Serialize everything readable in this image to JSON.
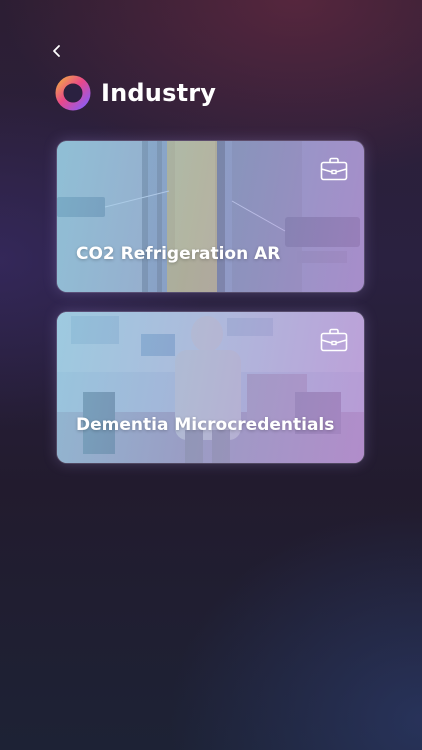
{
  "header": {
    "title": "Industry"
  },
  "cards": [
    {
      "label": "CO2 Refrigeration AR",
      "icon": "briefcase-icon"
    },
    {
      "label": "Dementia Microcredentials",
      "icon": "briefcase-icon"
    }
  ],
  "nav": {
    "back_icon": "chevron-left-icon"
  },
  "colors": {
    "accent_ring_start": "#f0a04b",
    "accent_ring_mid": "#e8488a",
    "accent_ring_end": "#8b5cf6"
  }
}
